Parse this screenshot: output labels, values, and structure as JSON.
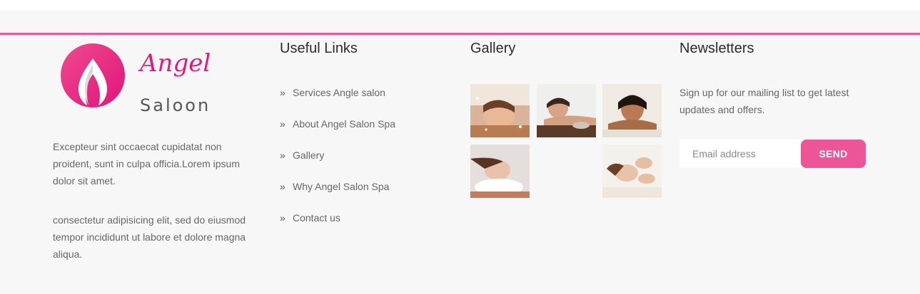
{
  "brand": {
    "logo_line1": "Angel",
    "logo_line2": "Saloon",
    "accent_color": "#ec5597"
  },
  "about": {
    "paragraph1": "Excepteur sint occaecat cupidatat non proident, sunt in culpa officia.Lorem ipsum dolor sit amet.",
    "paragraph2": "consectetur adipisicing elit, sed do eiusmod tempor incididunt ut labore et dolore magna aliqua."
  },
  "useful_links": {
    "title": "Useful Links",
    "icon": "double-chevron-right-icon",
    "items": [
      {
        "label": "Services Angle salon"
      },
      {
        "label": "About Angel Salon Spa"
      },
      {
        "label": "Gallery"
      },
      {
        "label": "Why Angel Salon Spa"
      },
      {
        "label": "Contact us"
      }
    ]
  },
  "gallery": {
    "title": "Gallery",
    "images": [
      {
        "name": "spa-woman-1"
      },
      {
        "name": "spa-woman-2"
      },
      {
        "name": "spa-woman-3"
      },
      {
        "name": "spa-woman-4"
      },
      {
        "name": "spa-woman-5"
      }
    ]
  },
  "newsletter": {
    "title": "Newsletters",
    "description": "Sign up for our mailing list to get latest updates and offers.",
    "email_placeholder": "Email address",
    "email_value": "",
    "send_label": "SEND"
  }
}
